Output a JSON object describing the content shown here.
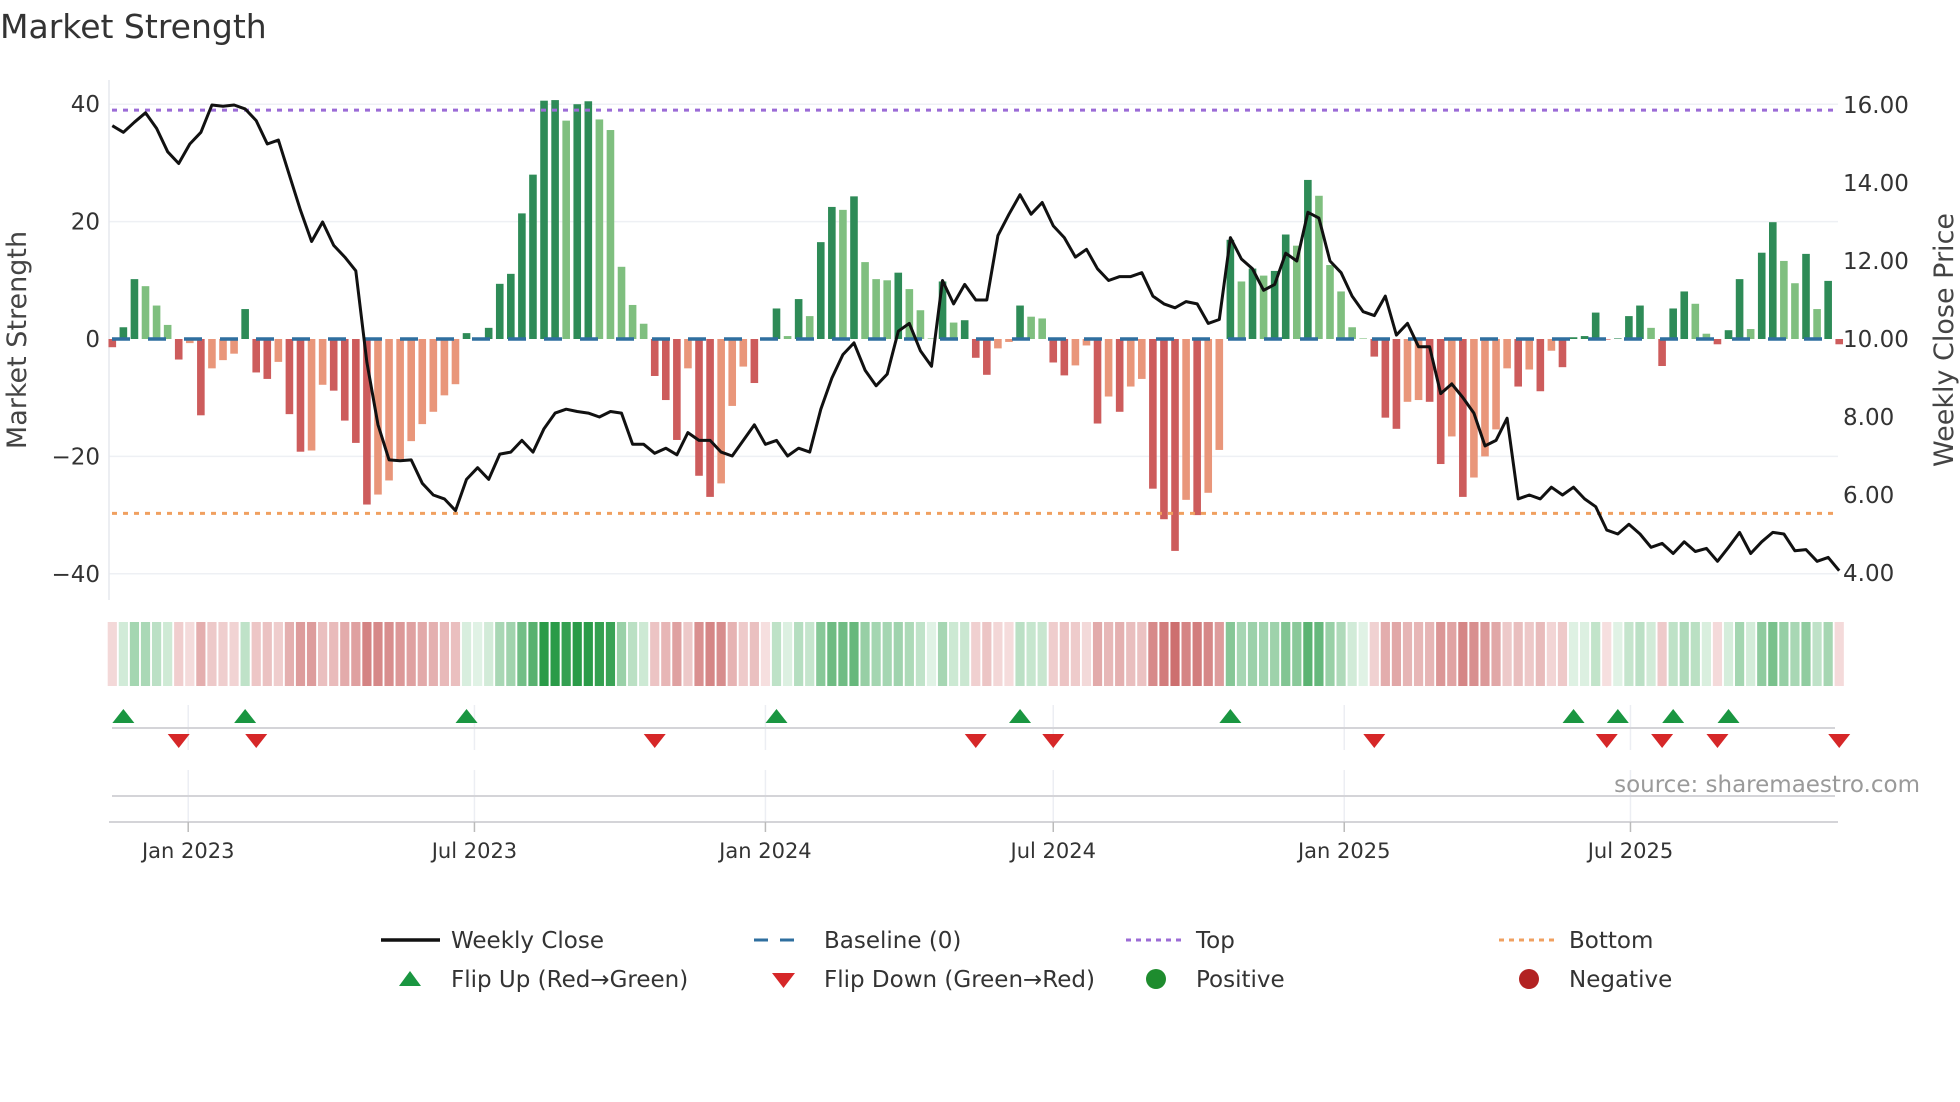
{
  "title": "Market Strength",
  "y_left_label": "Market Strength",
  "y_right_label": "Weekly Close Price",
  "source": "source: sharemaestro.com",
  "legend": {
    "weekly_close": "Weekly Close",
    "baseline": "Baseline (0)",
    "top": "Top",
    "bottom": "Bottom",
    "flip_up": "Flip Up (Red→Green)",
    "flip_down": "Flip Down (Green→Red)",
    "positive": "Positive",
    "negative": "Negative"
  },
  "colors": {
    "strong_green": "#2e8b57",
    "weak_green": "#7fbf7f",
    "strong_red": "#cd5c5c",
    "weak_red": "#e9967a",
    "price_line": "#111111",
    "baseline": "#2f6f9f",
    "top": "#9b6bd6",
    "bottom": "#f0a060",
    "flip_up": "#1a9641",
    "flip_down": "#d62728",
    "positive": "#1e8c2e",
    "negative": "#b22222"
  },
  "chart_data": {
    "type": "bar+line",
    "title": "Market Strength",
    "frequency": "weekly",
    "start_date": "2022-11-14",
    "ylabel_left": "Market Strength",
    "ylabel_right": "Weekly Close Price",
    "ylim_left": [
      -42,
      44
    ],
    "ylim_right": [
      3.33,
      16.0
    ],
    "left_ticks": [
      {
        "v": 40,
        "label": "40"
      },
      {
        "v": 20,
        "label": "20"
      },
      {
        "v": 0,
        "label": "0"
      },
      {
        "v": -20,
        "label": "−20"
      },
      {
        "v": -40,
        "label": "−40"
      }
    ],
    "right_ticks": [
      {
        "v": 16,
        "label": "16.00"
      },
      {
        "v": 14,
        "label": "14.00"
      },
      {
        "v": 12,
        "label": "12.00"
      },
      {
        "v": 10,
        "label": "10.00"
      },
      {
        "v": 8,
        "label": "8.00"
      },
      {
        "v": 6,
        "label": "6.00"
      },
      {
        "v": 4,
        "label": "4.00"
      }
    ],
    "x_ticks": [
      {
        "date": "2023-01-01",
        "label": "Jan 2023"
      },
      {
        "date": "2023-07-01",
        "label": "Jul 2023"
      },
      {
        "date": "2024-01-01",
        "label": "Jan 2024"
      },
      {
        "date": "2024-07-01",
        "label": "Jul 2024"
      },
      {
        "date": "2025-01-01",
        "label": "Jan 2025"
      },
      {
        "date": "2025-07-01",
        "label": "Jul 2025"
      }
    ],
    "top_threshold": 39.0,
    "bottom_threshold": -29.7,
    "baseline": 0,
    "strength": [
      -1.4,
      2.0,
      10.2,
      9.0,
      5.7,
      2.4,
      -3.5,
      -0.7,
      -13.0,
      -5.0,
      -3.6,
      -2.5,
      5.1,
      -5.7,
      -6.8,
      -3.9,
      -12.8,
      -19.2,
      -19.0,
      -7.8,
      -8.8,
      -13.9,
      -17.7,
      -28.2,
      -26.5,
      -24.1,
      -20.5,
      -17.4,
      -14.5,
      -12.4,
      -9.6,
      -7.7,
      1.0,
      0.1,
      1.9,
      9.4,
      11.1,
      21.4,
      28.0,
      40.6,
      40.7,
      37.2,
      40.0,
      40.5,
      37.4,
      35.6,
      12.3,
      5.8,
      2.6,
      -6.3,
      -10.4,
      -17.2,
      -5.0,
      -23.3,
      -26.9,
      -24.6,
      -11.4,
      -4.7,
      -7.5,
      -0.1,
      5.2,
      0.5,
      6.8,
      3.9,
      16.5,
      22.5,
      22.0,
      24.3,
      13.1,
      10.2,
      10.0,
      11.3,
      8.5,
      4.9,
      0.1,
      9.8,
      2.8,
      3.2,
      -3.2,
      -6.1,
      -1.6,
      -0.5,
      5.7,
      3.8,
      3.5,
      -4.0,
      -6.2,
      -4.5,
      -1.1,
      -14.4,
      -9.8,
      -12.4,
      -8.1,
      -6.8,
      -25.5,
      -30.7,
      -36.1,
      -27.4,
      -30.0,
      -26.2,
      -18.9,
      16.9,
      9.8,
      12.0,
      10.8,
      11.6,
      17.8,
      15.9,
      27.1,
      24.4,
      12.6,
      8.1,
      2.0,
      0.1,
      -3.0,
      -13.4,
      -15.3,
      -10.7,
      -10.4,
      -10.7,
      -21.3,
      -16.6,
      -26.9,
      -23.6,
      -20.0,
      -15.4,
      -5.0,
      -8.1,
      -5.2,
      -8.9,
      -2.0,
      -4.8,
      0.3,
      0.5,
      4.5,
      -0.1,
      0.1,
      3.9,
      5.7,
      1.9,
      -4.6,
      5.2,
      8.1,
      6.0,
      0.9,
      -0.9,
      1.5,
      10.2,
      1.7,
      14.7,
      19.9,
      13.3,
      9.5,
      14.5,
      5.1,
      9.9,
      -0.9
    ],
    "weekly_close": [
      15.47,
      15.3,
      15.56,
      15.8,
      15.4,
      14.8,
      14.5,
      15.0,
      15.3,
      16.0,
      15.97,
      16.0,
      15.9,
      15.6,
      15.0,
      15.1,
      14.2,
      13.3,
      12.5,
      13.0,
      12.4,
      12.1,
      11.75,
      9.4,
      7.8,
      6.9,
      6.88,
      6.9,
      6.3,
      6.0,
      5.9,
      5.6,
      6.4,
      6.7,
      6.4,
      7.05,
      7.1,
      7.4,
      7.1,
      7.7,
      8.1,
      8.2,
      8.14,
      8.1,
      8.0,
      8.14,
      8.1,
      7.3,
      7.3,
      7.07,
      7.2,
      7.03,
      7.6,
      7.4,
      7.4,
      7.1,
      7.0,
      7.4,
      7.8,
      7.3,
      7.4,
      7.0,
      7.2,
      7.1,
      8.2,
      9.0,
      9.6,
      9.9,
      9.2,
      8.8,
      9.1,
      10.2,
      10.4,
      9.7,
      9.3,
      11.5,
      10.9,
      11.4,
      11.0,
      11.0,
      12.65,
      13.2,
      13.7,
      13.2,
      13.5,
      12.9,
      12.6,
      12.1,
      12.3,
      11.8,
      11.5,
      11.6,
      11.6,
      11.7,
      11.1,
      10.9,
      10.8,
      10.96,
      10.9,
      10.4,
      10.5,
      12.6,
      12.05,
      11.8,
      11.25,
      11.4,
      12.2,
      12.0,
      13.25,
      13.1,
      12.0,
      11.7,
      11.1,
      10.7,
      10.6,
      11.1,
      10.1,
      10.4,
      9.8,
      9.8,
      8.6,
      8.85,
      8.5,
      8.1,
      7.26,
      7.4,
      7.97,
      5.9,
      6.0,
      5.9,
      6.2,
      6.0,
      6.2,
      5.9,
      5.7,
      5.1,
      5.0,
      5.25,
      5.0,
      4.66,
      4.76,
      4.5,
      4.8,
      4.55,
      4.63,
      4.3,
      4.66,
      5.04,
      4.5,
      4.8,
      5.04,
      5.0,
      4.57,
      4.6,
      4.3,
      4.4,
      4.06
    ]
  }
}
